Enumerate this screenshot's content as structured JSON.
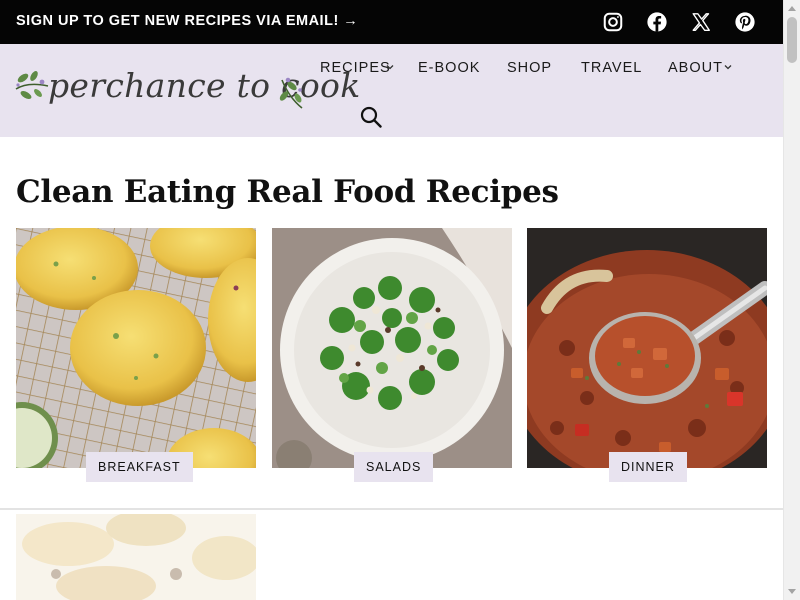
{
  "topbar": {
    "signup_text": "SIGN UP TO GET NEW RECIPES VIA EMAIL! →",
    "social_icons": [
      "instagram-icon",
      "facebook-icon",
      "x-icon",
      "pinterest-icon"
    ]
  },
  "header": {
    "logo_text": "perchance to cook",
    "nav": {
      "recipes": "RECIPES",
      "ebook": "E-BOOK",
      "shop": "SHOP",
      "travel": "TRAVEL",
      "about": "ABOUT"
    }
  },
  "main": {
    "title": "Clean Eating Real Food Recipes",
    "categories": [
      "BREAKFAST",
      "SALADS",
      "DINNER"
    ]
  },
  "colors": {
    "topbar_bg": "#050505",
    "header_bg": "#e8e3ef",
    "label_bg": "#e8e3ef",
    "leaf_green": "#5e8a45",
    "leaf_purple": "#9b86c4"
  }
}
